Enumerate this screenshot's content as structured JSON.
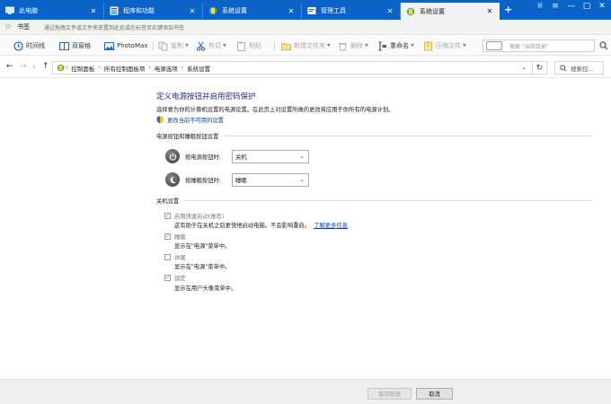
{
  "tabs": [
    {
      "label": "此电脑",
      "active": false
    },
    {
      "label": "程序和功能",
      "active": false
    },
    {
      "label": "系统设置",
      "active": false
    },
    {
      "label": "管理工具",
      "active": false
    },
    {
      "label": "系统设置",
      "active": true
    }
  ],
  "new_tab": "+",
  "bookmarks": {
    "label": "书签",
    "hint": "通过拖拽文件或文件夹放置到此处或在标签页右键添加书签"
  },
  "toolbar": {
    "timeline": "时间线",
    "dual_pane": "双窗格",
    "photomax": "PhotoMax",
    "copy": "复制",
    "cut": "剪切",
    "paste": "粘贴",
    "new_folder": "新建文件夹",
    "delete": "删除",
    "rename": "重命名",
    "compress": "压缩文件",
    "search_placeholder": "搜索 \"当前目录\""
  },
  "address": {
    "crumbs": [
      "控制面板",
      "所有控制面板项",
      "电源选项",
      "系统设置"
    ],
    "search_placeholder": "搜索控..."
  },
  "content": {
    "title": "定义电源按钮并启用密码保护",
    "description": "选择要为你的计算机设置的电源设置。在此页上对设置所做的更改将应用于你所有的电源计划。",
    "change_link": "更改当前不可用的设置",
    "power_section": "电源按钮和睡眠按钮设置",
    "power_button_label": "按电源按钮时:",
    "power_button_value": "关机",
    "sleep_button_label": "按睡眠按钮时:",
    "sleep_button_value": "睡眠",
    "shutdown_section": "关机设置",
    "fast_startup_label": "启用快速启动(推荐)",
    "fast_startup_desc": "这有助于在关机之后更快地启动电脑。不会影响重启。",
    "learn_more": "了解更多信息",
    "sleep_label": "睡眠",
    "sleep_desc": "显示在\"电源\"菜单中。",
    "hibernate_label": "休眠",
    "hibernate_desc": "显示在\"电源\"菜单中。",
    "lock_label": "锁定",
    "lock_desc": "显示在用户头像菜单中。",
    "checked": {
      "fast_startup": true,
      "sleep": true,
      "hibernate": false,
      "lock": true
    }
  },
  "footer": {
    "save": "保存修改",
    "cancel": "取消"
  },
  "colors": {
    "titlebar": "#0a64c8",
    "heading": "#1e3287",
    "link": "#0645ad"
  }
}
